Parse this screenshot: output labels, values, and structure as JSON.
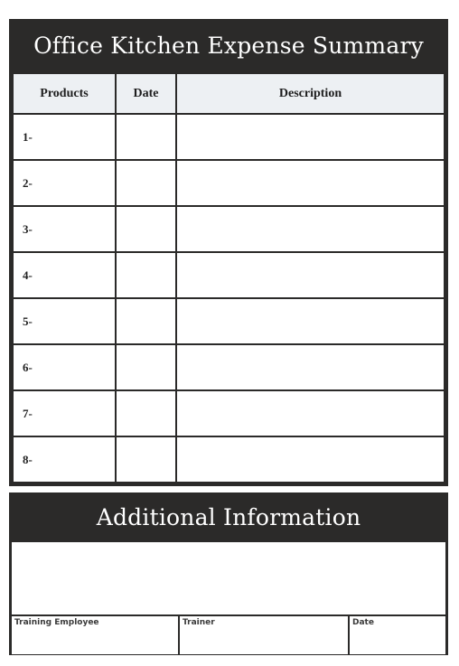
{
  "title": "Office Kitchen Expense Summary",
  "table": {
    "headers": [
      "Products",
      "Date",
      "Description"
    ],
    "rows": [
      {
        "number": "1-",
        "date": "",
        "description": ""
      },
      {
        "number": "2-",
        "date": "",
        "description": ""
      },
      {
        "number": "3-",
        "date": "",
        "description": ""
      },
      {
        "number": "4-",
        "date": "",
        "description": ""
      },
      {
        "number": "5-",
        "date": "",
        "description": ""
      },
      {
        "number": "6-",
        "date": "",
        "description": ""
      },
      {
        "number": "7-",
        "date": "",
        "description": ""
      },
      {
        "number": "8-",
        "date": "",
        "description": ""
      }
    ]
  },
  "additional": {
    "title": "Additional Information",
    "notes": "",
    "signatures": [
      "Training Employee",
      "Trainer",
      "Date"
    ]
  },
  "colors": {
    "frame": "#2b2a29",
    "header_bg": "#edf0f3"
  }
}
